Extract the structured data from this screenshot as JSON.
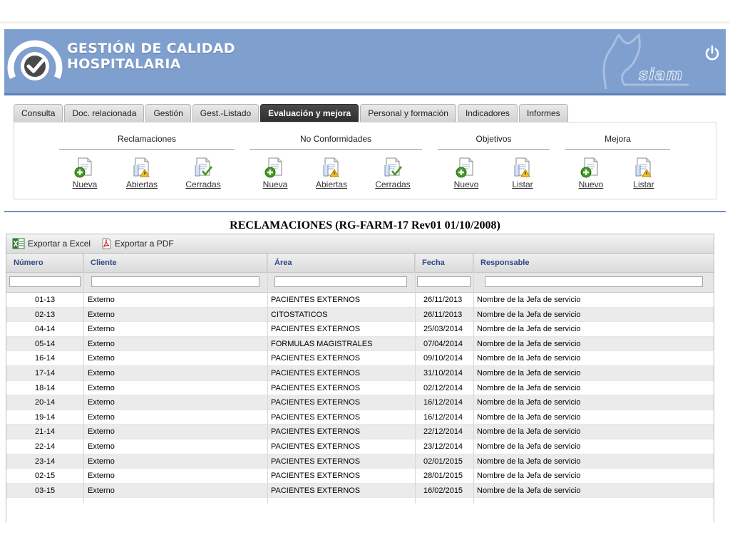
{
  "app": {
    "title_line1": "GESTIÓN DE CALIDAD",
    "title_line2": "HOSPITALARIA",
    "brand": "siam"
  },
  "colors": {
    "header": "#7f9fcf",
    "active_tab": "#333333",
    "column_header_text": "#2c4a86",
    "separator": "#6e8fc4"
  },
  "tabs": [
    {
      "label": "Consulta",
      "active": false
    },
    {
      "label": "Doc. relacionada",
      "active": false
    },
    {
      "label": "Gestión",
      "active": false
    },
    {
      "label": "Gest.-Listado",
      "active": false
    },
    {
      "label": "Evaluación y mejora",
      "active": true
    },
    {
      "label": "Personal y formación",
      "active": false
    },
    {
      "label": "Indicadores",
      "active": false
    },
    {
      "label": "Informes",
      "active": false
    }
  ],
  "groups": [
    {
      "title": "Reclamaciones",
      "actions": [
        {
          "label": "Nueva",
          "icon": "doc-add-icon"
        },
        {
          "label": "Abiertas",
          "icon": "doc-warning-icon"
        },
        {
          "label": "Cerradas",
          "icon": "doc-check-icon"
        }
      ]
    },
    {
      "title": "No Conformidades",
      "actions": [
        {
          "label": "Nueva",
          "icon": "doc-add-icon"
        },
        {
          "label": "Abiertas",
          "icon": "doc-warning-icon"
        },
        {
          "label": "Cerradas",
          "icon": "doc-check-icon"
        }
      ]
    },
    {
      "title": "Objetivos",
      "actions": [
        {
          "label": "Nuevo",
          "icon": "doc-add-icon"
        },
        {
          "label": "Listar",
          "icon": "doc-warning-icon"
        }
      ]
    },
    {
      "title": "Mejora",
      "actions": [
        {
          "label": "Nuevo",
          "icon": "doc-add-icon"
        },
        {
          "label": "Listar",
          "icon": "doc-warning-icon"
        }
      ]
    }
  ],
  "report": {
    "title": "RECLAMACIONES (RG-FARM-17 Rev01 01/10/2008)",
    "export_excel": "Exportar a Excel",
    "export_pdf": "Exportar a PDF",
    "columns": [
      "Número",
      "Cliente",
      "Área",
      "Fecha",
      "Responsable"
    ],
    "rows": [
      [
        "01-13",
        "Externo",
        "PACIENTES EXTERNOS",
        "26/11/2013",
        "Nombre de la Jefa de servicio"
      ],
      [
        "02-13",
        "Externo",
        "CITOSTATICOS",
        "26/11/2013",
        "Nombre de la Jefa de servicio"
      ],
      [
        "04-14",
        "Externo",
        "PACIENTES EXTERNOS",
        "25/03/2014",
        "Nombre de la Jefa de servicio"
      ],
      [
        "05-14",
        "Externo",
        "FORMULAS MAGISTRALES",
        "07/04/2014",
        "Nombre de la Jefa de servicio"
      ],
      [
        "16-14",
        "Externo",
        "PACIENTES EXTERNOS",
        "09/10/2014",
        "Nombre de la Jefa de servicio"
      ],
      [
        "17-14",
        "Externo",
        "PACIENTES EXTERNOS",
        "31/10/2014",
        "Nombre de la Jefa de servicio"
      ],
      [
        "18-14",
        "Externo",
        "PACIENTES EXTERNOS",
        "02/12/2014",
        "Nombre de la Jefa de servicio"
      ],
      [
        "20-14",
        "Externo",
        "PACIENTES EXTERNOS",
        "16/12/2014",
        "Nombre de la Jefa de servicio"
      ],
      [
        "19-14",
        "Externo",
        "PACIENTES EXTERNOS",
        "16/12/2014",
        "Nombre de la Jefa de servicio"
      ],
      [
        "21-14",
        "Externo",
        "PACIENTES EXTERNOS",
        "22/12/2014",
        "Nombre de la Jefa de servicio"
      ],
      [
        "22-14",
        "Externo",
        "PACIENTES EXTERNOS",
        "23/12/2014",
        "Nombre de la Jefa de servicio"
      ],
      [
        "23-14",
        "Externo",
        "PACIENTES EXTERNOS",
        "02/01/2015",
        "Nombre de la Jefa de servicio"
      ],
      [
        "02-15",
        "Externo",
        "PACIENTES EXTERNOS",
        "28/01/2015",
        "Nombre de la Jefa de servicio"
      ],
      [
        "03-15",
        "Externo",
        "PACIENTES EXTERNOS",
        "16/02/2015",
        "Nombre de la Jefa de servicio"
      ]
    ]
  }
}
